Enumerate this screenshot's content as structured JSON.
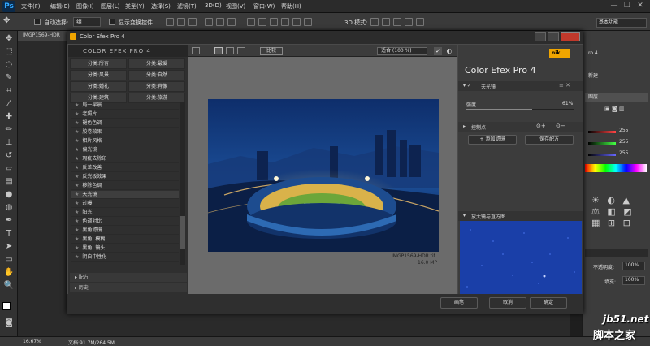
{
  "app": {
    "logo": "Ps"
  },
  "menubar": {
    "items": [
      "文件(F)",
      "编辑(E)",
      "图像(I)",
      "图层(L)",
      "类型(Y)",
      "选择(S)",
      "滤镜(T)",
      "3D(D)",
      "视图(V)",
      "窗口(W)",
      "帮助(H)"
    ],
    "minimize": "—",
    "restore": "❐",
    "close": "✕"
  },
  "optionsbar": {
    "auto_select_label": "自动选择:",
    "auto_select_value": "组",
    "show_transform_label": "显示变换控件",
    "mode_3d_label": "3D 模式:",
    "workspace": "基本功能"
  },
  "document": {
    "tab": "IMGP1569-HDR",
    "zoom": "16.67%",
    "doc_size": "文档:91.7M/264.5M"
  },
  "plugin": {
    "title": "Color Efex Pro 4",
    "brand": "COLOR EFEX PRO 4",
    "categories": [
      "分类:所有",
      "分类:最爱",
      "分类:风景",
      "分类:自然",
      "分类:婚礼",
      "分类:肖像",
      "分类:建筑",
      "分类:旅游"
    ],
    "filters": [
      "局一早晨",
      "老照片",
      "褪色色调",
      "胶卷效果",
      "相片风格",
      "偏光镜",
      "瑕疵去除印",
      "反差改善",
      "反光板效果",
      "移除色调",
      "天光镜",
      "过曝",
      "阳光",
      "色调对比",
      "黑角滤镜",
      "黑角: 模糊",
      "黑角: 镜头",
      "阴白中性化"
    ],
    "recipes_label": "配方",
    "history_label": "历史",
    "compare_label": "比较",
    "zoom_select": "适合 (100 %)",
    "preview_ok": "✓",
    "image_filename": "IMGP1569-HDR.tif",
    "image_megapixels": "16.0 MP",
    "nik_logo": "nik",
    "right_title": "Color Efex Pro",
    "right_version": "4",
    "active_filter": "天光镜",
    "strength_label": "强度",
    "strength_value": "61%",
    "strength_fraction": 0.61,
    "control_points_label": "控制点",
    "add_filter_label": "添加滤镜",
    "save_recipe_label": "保存配方",
    "loupe_label": "放大镜与直方图",
    "bottom_left_btn1": "帮助",
    "bottom_left_btn2": "设置",
    "btn_brush": "画笔",
    "btn_cancel": "取消",
    "btn_ok": "确定"
  },
  "right_panel": {
    "layer_fragment": "ro 4",
    "new_fragment": "新建",
    "layer_label": "图层",
    "rgb_values": [
      "255",
      "255",
      "255"
    ],
    "opacity_label": "不透明度:",
    "opacity_value": "100%",
    "fill_label": "填充:",
    "fill_value": "100%"
  },
  "watermark": {
    "site": "jb51.net",
    "name": "脚本之家"
  },
  "colors": {
    "accent": "#f0a500",
    "ps_blue": "#31a8ff"
  }
}
